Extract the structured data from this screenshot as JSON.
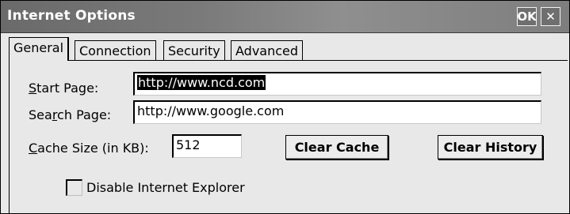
{
  "window": {
    "title": "Internet Options",
    "ok_label": "OK",
    "close_glyph": "✕"
  },
  "tabs": [
    {
      "label": "General",
      "active": true
    },
    {
      "label": "Connection",
      "active": false
    },
    {
      "label": "Security",
      "active": false
    },
    {
      "label": "Advanced",
      "active": false
    }
  ],
  "general": {
    "start_page": {
      "label_first": "S",
      "label_rest": "tart Page:",
      "value": "http://www.ncd.com"
    },
    "search_page": {
      "label_pre": "Sea",
      "label_acc": "r",
      "label_post": "ch Page:",
      "value": "http://www.google.com"
    },
    "cache_size": {
      "label_first": "C",
      "label_rest": "ache Size (in KB):",
      "value": "512"
    },
    "clear_cache_label": "Clear Cache",
    "clear_history_label": "Clear History",
    "disable_ie": {
      "label": "Disable Internet Explorer",
      "checked": false
    }
  }
}
